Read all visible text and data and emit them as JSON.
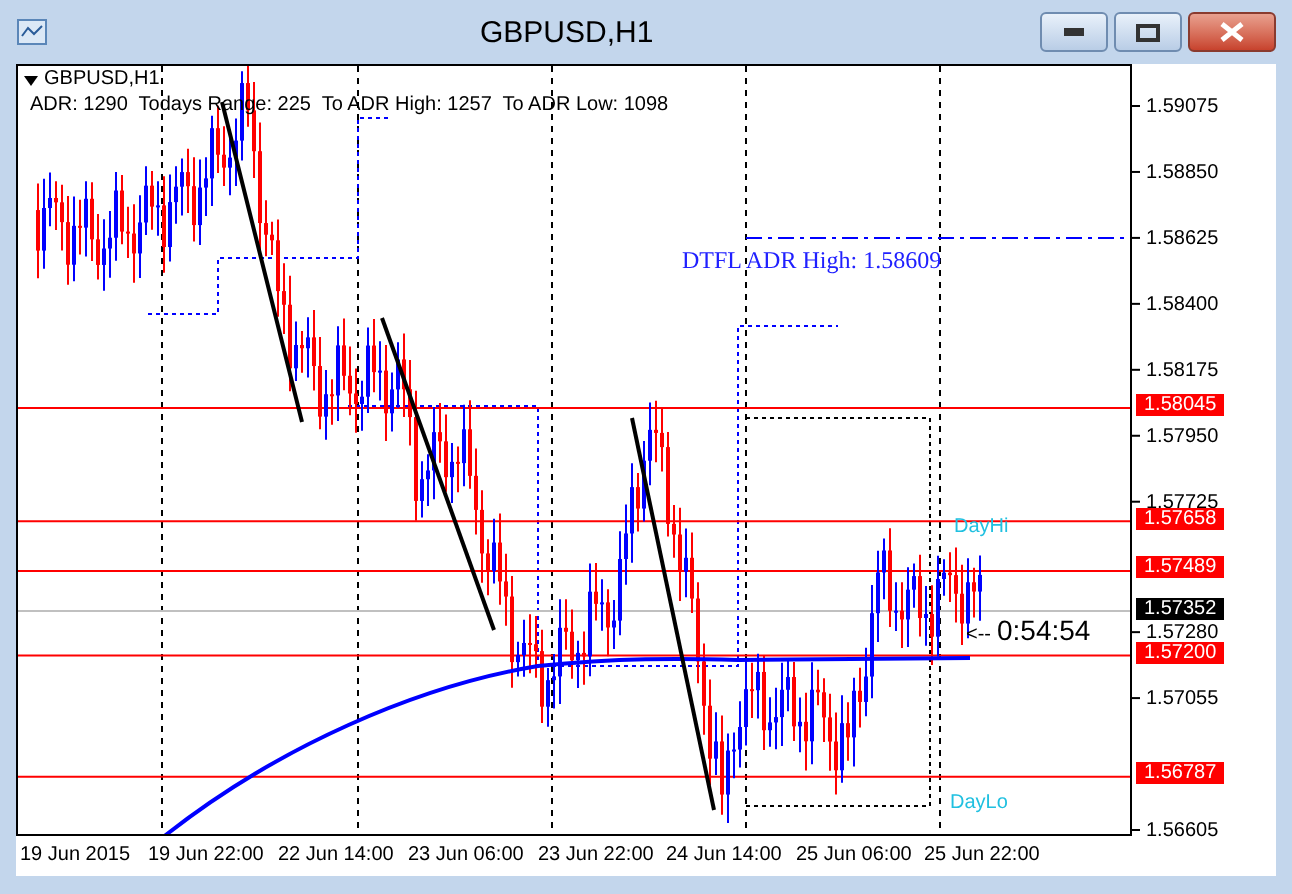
{
  "window": {
    "title": "GBPUSD,H1"
  },
  "chart": {
    "symbol": "GBPUSD,H1",
    "info": "ADR: 1290  Todays Range: 225  To ADR High: 1257  To ADR Low: 1098",
    "adr_label": "DTFL ADR High: 1.58609",
    "day_high_label": "DayHi",
    "day_low_label": "DayLo",
    "countdown": {
      "arrow": "<--",
      "time": "0:54:54"
    },
    "price_ticks": [
      "1.59075",
      "1.58850",
      "1.58625",
      "1.58400",
      "1.58175",
      "1.57950",
      "1.57725",
      "1.57280",
      "1.57055",
      "1.56605"
    ],
    "price_lines": [
      {
        "price": "1.58045"
      },
      {
        "price": "1.57658"
      },
      {
        "price": "1.57489"
      },
      {
        "price": "1.57200"
      },
      {
        "price": "1.56787"
      }
    ],
    "current_price": "1.57352",
    "time_labels": [
      "19 Jun 2015",
      "19 Jun 22:00",
      "22 Jun 14:00",
      "23 Jun 06:00",
      "23 Jun 22:00",
      "24 Jun 14:00",
      "25 Jun 06:00",
      "25 Jun 22:00"
    ]
  }
}
